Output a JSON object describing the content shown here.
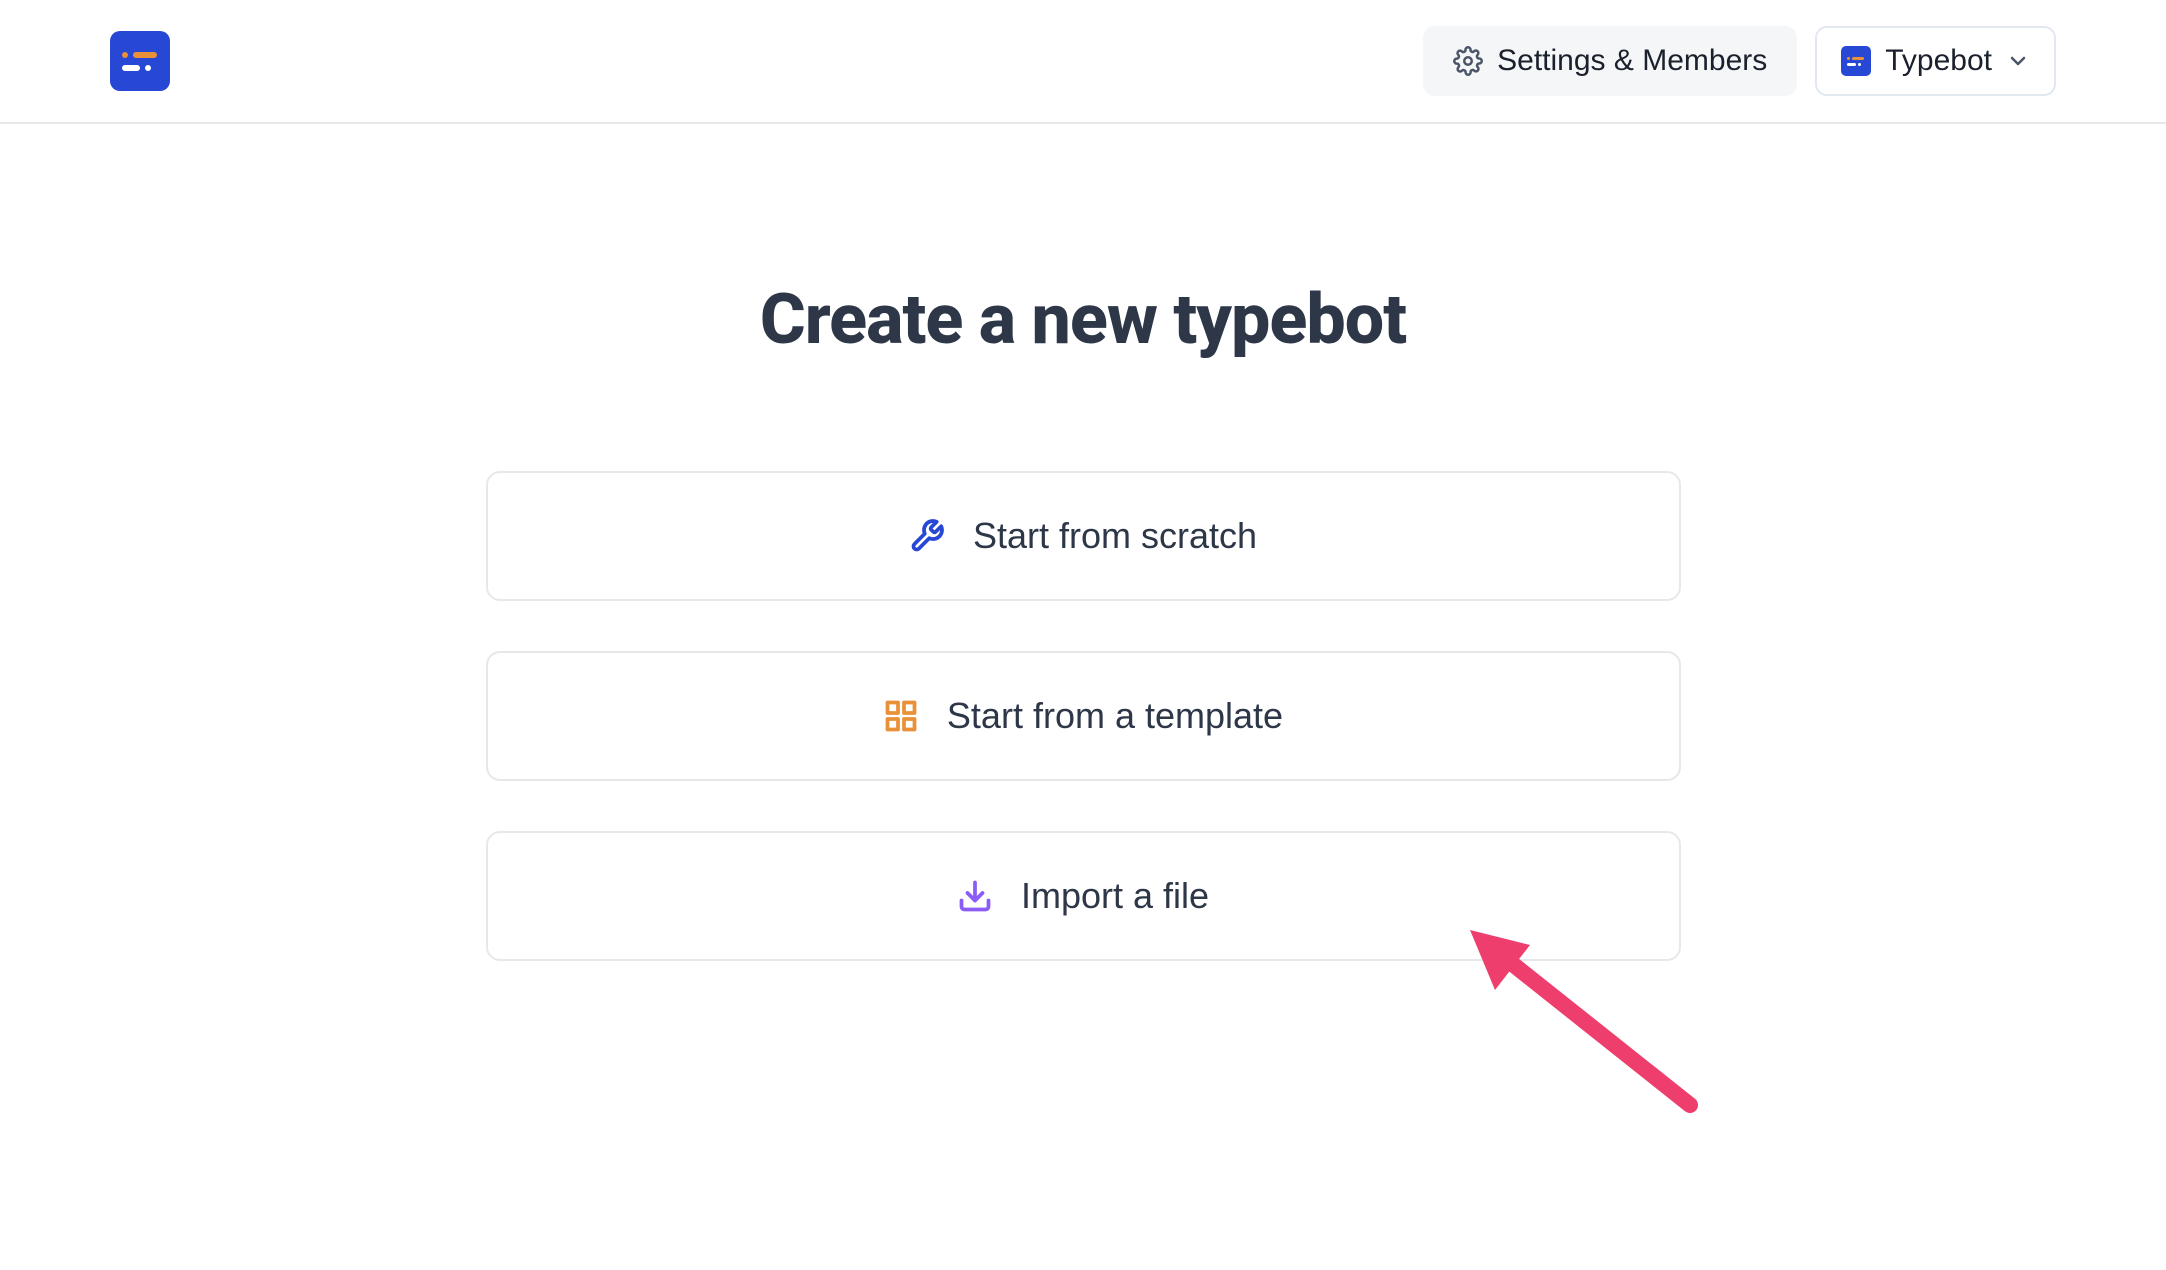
{
  "header": {
    "settings_label": "Settings & Members",
    "workspace_label": "Typebot"
  },
  "main": {
    "title": "Create a new typebot",
    "options": [
      {
        "label": "Start from scratch",
        "icon": "wrench"
      },
      {
        "label": "Start from a template",
        "icon": "grid"
      },
      {
        "label": "Import a file",
        "icon": "download"
      }
    ]
  }
}
